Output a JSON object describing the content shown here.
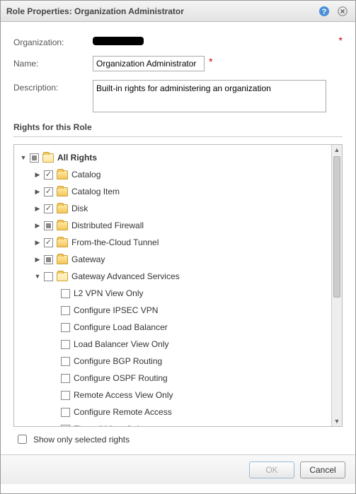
{
  "window": {
    "title": "Role Properties: Organization Administrator"
  },
  "form": {
    "org_label": "Organization:",
    "org_value": "",
    "name_label": "Name:",
    "name_value": "Organization Administrator",
    "desc_label": "Description:",
    "desc_value": "Built-in rights for administering an organization"
  },
  "rights_section_title": "Rights for this Role",
  "tree": {
    "root": {
      "label": "All Rights",
      "state": "partial",
      "expanded": true
    },
    "items": [
      {
        "label": "Catalog",
        "state": "checked",
        "expandable": true,
        "expanded": false
      },
      {
        "label": "Catalog Item",
        "state": "checked",
        "expandable": true,
        "expanded": false
      },
      {
        "label": "Disk",
        "state": "checked",
        "expandable": true,
        "expanded": false
      },
      {
        "label": "Distributed Firewall",
        "state": "partial",
        "expandable": true,
        "expanded": false
      },
      {
        "label": "From-the-Cloud Tunnel",
        "state": "checked",
        "expandable": true,
        "expanded": false
      },
      {
        "label": "Gateway",
        "state": "partial",
        "expandable": true,
        "expanded": false
      },
      {
        "label": "Gateway Advanced Services",
        "state": "unchecked",
        "expandable": true,
        "expanded": true,
        "children": [
          {
            "label": "L2 VPN View Only",
            "state": "unchecked"
          },
          {
            "label": "Configure IPSEC VPN",
            "state": "unchecked"
          },
          {
            "label": "Configure Load Balancer",
            "state": "unchecked"
          },
          {
            "label": "Load Balancer View Only",
            "state": "unchecked"
          },
          {
            "label": "Configure BGP Routing",
            "state": "unchecked"
          },
          {
            "label": "Configure OSPF Routing",
            "state": "unchecked"
          },
          {
            "label": "Remote Access View Only",
            "state": "unchecked"
          },
          {
            "label": "Configure Remote Access",
            "state": "unchecked"
          },
          {
            "label": "Firewall View Only",
            "state": "unchecked"
          }
        ]
      }
    ]
  },
  "footer": {
    "show_selected_label": "Show only selected rights",
    "ok_label": "OK",
    "cancel_label": "Cancel"
  }
}
